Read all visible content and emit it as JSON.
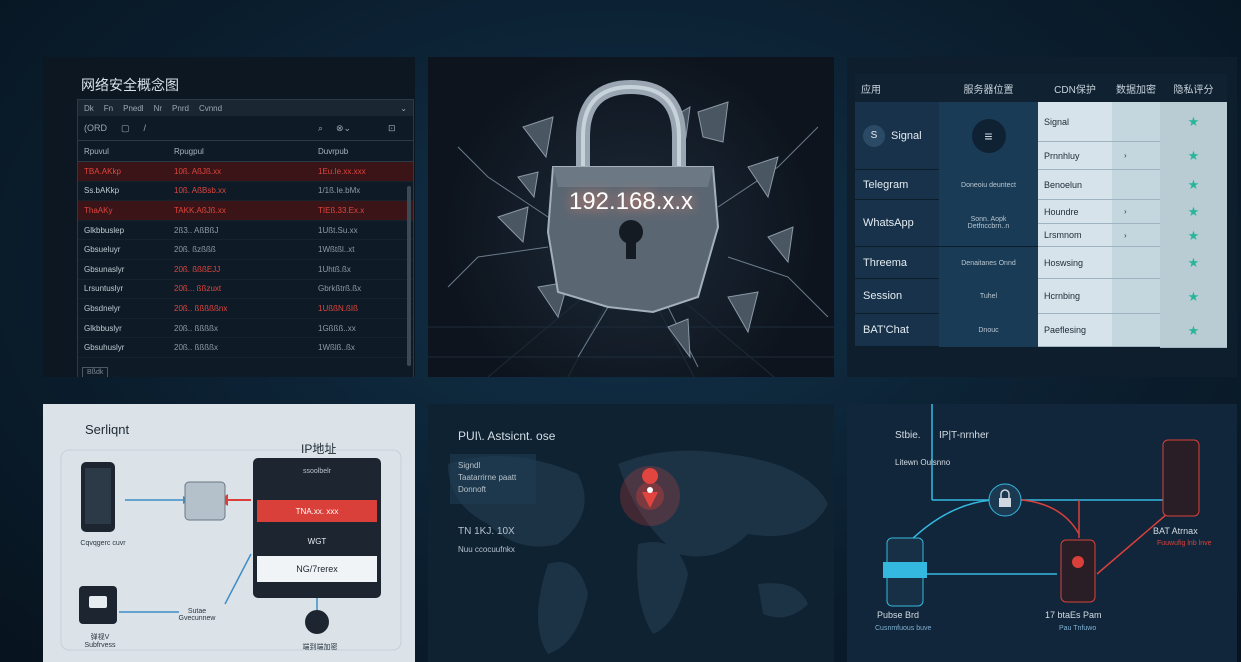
{
  "panel1": {
    "title": "网络安全概念图",
    "menu": [
      "Dk",
      "Fn",
      "Pnedl",
      "Nr",
      "Pnrd",
      "Cvnnd"
    ],
    "toolbar": [
      "(ORD",
      "▢",
      "/"
    ],
    "headers": [
      "Rpuvul",
      "Rpugpul",
      "Duvrpub"
    ],
    "rows": [
      {
        "a": "TBA.AKkp",
        "b": "10ß. AßJß.xx",
        "c": "1Eu.Ie.xx.xxx",
        "hl": true
      },
      {
        "a": "Ss.bAKkp",
        "b": "10ß. AßBsb.xx",
        "c": "1/1ß.Ie.bMx",
        "hl": false
      },
      {
        "a": "ThaAKy",
        "b": "TAKK.AßJß.xx",
        "c": "TIEß.33.Ex.x",
        "hl": true
      },
      {
        "a": "Glkbbuslep",
        "b": "2ß3.. AßBßJ",
        "c": "1Ußt.Su.xx",
        "hl": false
      },
      {
        "a": "Gbsueluyr",
        "b": "20ß. ßzßßß",
        "c": "1Wßtßl..xt",
        "hl": false
      },
      {
        "a": "Gbsunaslyr",
        "b": "20ß. ßßßEJJ",
        "c": "1Uhtß.ßx",
        "hl": false
      },
      {
        "a": "Lrsuntuslyr",
        "b": "20ß... ßßzuxt",
        "c": "Gbrkßtrß.ßx",
        "hl": false
      },
      {
        "a": "Gbsdnelyr",
        "b": "20ß.. ßßßßßnx",
        "c": "1UßßN.ßIß",
        "hl": false
      },
      {
        "a": "Glkbbuslyr",
        "b": "20ß.. ßßßßx",
        "c": "1Gßßß..xx",
        "hl": false
      },
      {
        "a": "Gbsuhuslyr",
        "b": "20ß.. ßßßßx",
        "c": "1Wßlß..ßx",
        "hl": false
      }
    ],
    "status": "Bßdk"
  },
  "panel2": {
    "ip": "192.168.x.x"
  },
  "panel3": {
    "headers": [
      "应用",
      "服务器位置",
      "CDN保护",
      "数据加密",
      "隐私评分"
    ],
    "apps": [
      "Signal",
      "Telegram",
      "WhatsApp",
      "Threema",
      "Session",
      "BAT'Chat"
    ],
    "cdn": [
      "",
      "Doneoiu deuntect",
      "Sonn. Aopk Detfnccbrn..n",
      "Denaitanes Onnd",
      "Tuhel",
      "Dnouc"
    ],
    "storage": [
      "Signal",
      "Prnnhluy",
      "Benoelun",
      "Houndre",
      "Lrsmnom",
      "Hoswsing",
      "Hcrnbing",
      "Paeflesing"
    ],
    "star": "★"
  },
  "panel4": {
    "title": "Serliqnt",
    "title2": "IP地址",
    "phone_label": "Cqvqgerc cuvr",
    "chat_label": "弹视V\nSubfrvess",
    "center_label": "Sutae\nGvecunnew",
    "bottom_label": "端到端加密",
    "dark_header": "ssoolbelr",
    "red_bar": "TNA.xx. xxx",
    "dark_bar": "WGT",
    "white_bar": "NG/7rerex"
  },
  "panel5": {
    "title": "PUI\\. Astsicnt. ose",
    "box_text": "Signdl\nTaatarrirne paatt\nDonnoft",
    "lower_text1": "TN 1KJ. 10X",
    "lower_text2": "Nuu ccocuufnkx"
  },
  "panel6": {
    "label1": "Stbie.",
    "label2": "IP|T-nrnher",
    "label3": "Litewn  Oulsnno",
    "device_left": "Pubse Brd",
    "device_left_sub": "Cusnmfuous buve",
    "device_center": "17 btaEs Pam",
    "device_center_sub": "Pau  Tnfuwo",
    "device_right": "BAT Atrnax",
    "device_right_sub": "Fuuwufig lnb lnve"
  },
  "colors": {
    "accent_red": "#d9403a",
    "teal_star": "#27b69a",
    "cyan": "#35b8e0"
  }
}
